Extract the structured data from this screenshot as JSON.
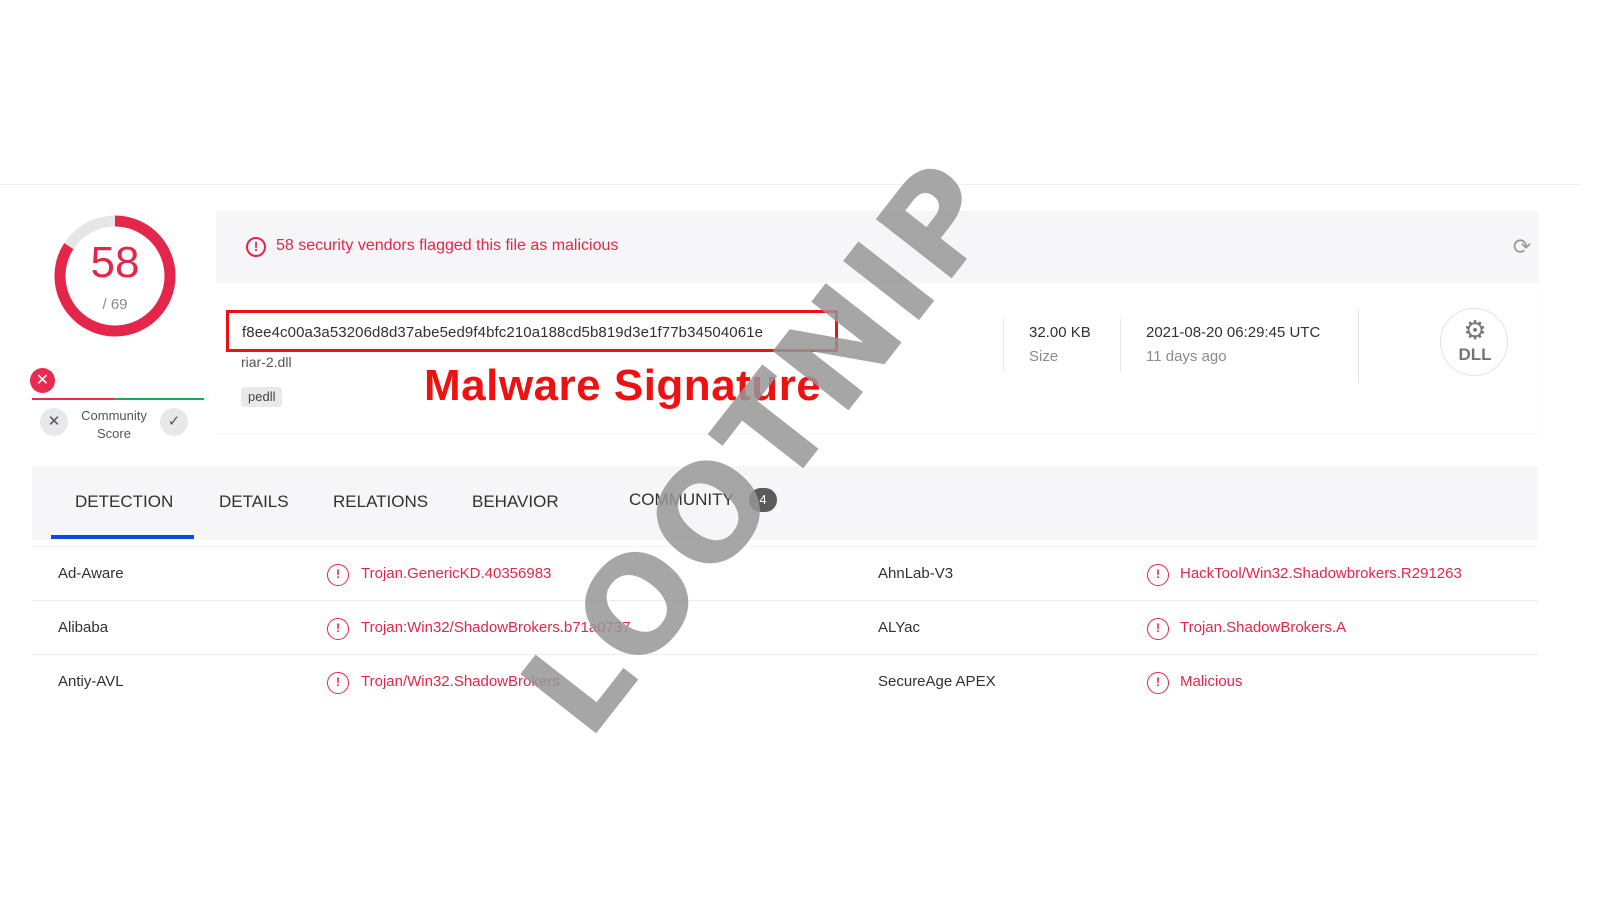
{
  "score": {
    "detected": "58",
    "total": "/ 69",
    "detected_fraction": 0.8406
  },
  "community": {
    "badge_icon": "x-icon",
    "label": "Community Score",
    "vote_down_icon": "x-icon",
    "vote_up_icon": "check-icon"
  },
  "summary": {
    "alert_text": "58 security vendors flagged this file as malicious",
    "alert_icon": "exclamation-circle-icon",
    "refresh_icon": "refresh-icon",
    "hash": "f8ee4c00a3a53206d8d37abe5ed9f4bfc210a188cd5b819d3e1f77b34504061e",
    "file_name": "riar-2.dll",
    "tag": "pedll",
    "size_value": "32.00 KB",
    "size_label": "Size",
    "date_value": "2021-08-20 06:29:45 UTC",
    "date_relative": "11 days ago",
    "file_type_label": "DLL",
    "file_type_icon": "gear-icon"
  },
  "annotation": "Malware Signature",
  "tabs": [
    {
      "label": "DETECTION",
      "active": true
    },
    {
      "label": "DETAILS",
      "active": false
    },
    {
      "label": "RELATIONS",
      "active": false
    },
    {
      "label": "BEHAVIOR",
      "active": false
    },
    {
      "label": "COMMUNITY",
      "active": false,
      "badge": "4"
    }
  ],
  "detections": [
    {
      "vendor_left": "Ad-Aware",
      "verdict_left": "Trojan.GenericKD.40356983",
      "vendor_right": "AhnLab-V3",
      "verdict_right": "HackTool/Win32.Shadowbrokers.R291263"
    },
    {
      "vendor_left": "Alibaba",
      "verdict_left": "Trojan:Win32/ShadowBrokers.b71a0737",
      "vendor_right": "ALYac",
      "verdict_right": "Trojan.ShadowBrokers.A"
    },
    {
      "vendor_left": "Antiy-AVL",
      "verdict_left": "Trojan/Win32.ShadowBrokers",
      "vendor_right": "SecureAge APEX",
      "verdict_right": "Malicious"
    }
  ],
  "watermark": "LOOTNIP",
  "colors": {
    "malicious": "#e4264a",
    "annotation": "#ee1111",
    "active_tab": "#0b4dda",
    "harmless": "#20a55c"
  }
}
